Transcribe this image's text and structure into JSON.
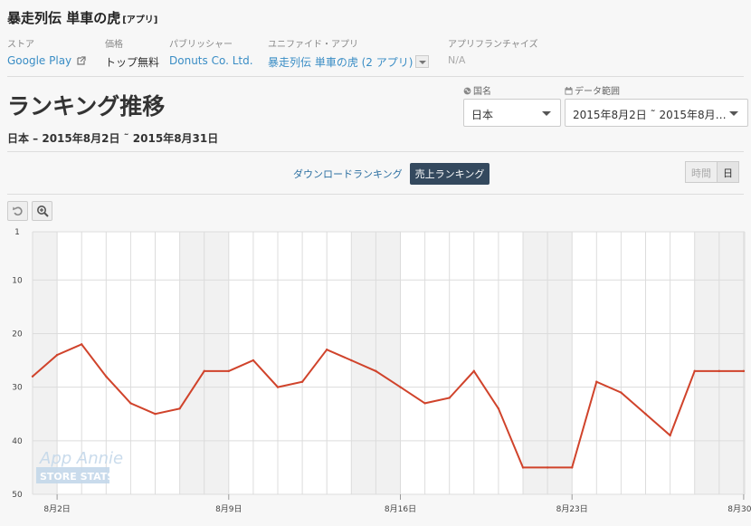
{
  "app": {
    "name": "暴走列伝 単車の虎",
    "tag": "[アプリ]"
  },
  "meta": {
    "store": {
      "label": "ストア",
      "value": "Google Play"
    },
    "price": {
      "label": "価格",
      "value": "トップ無料"
    },
    "publisher": {
      "label": "パブリッシャー",
      "value": "Donuts Co. Ltd."
    },
    "unified": {
      "label": "ユニファイド・アプリ",
      "value": "暴走列伝 単車の虎 (2 アプリ)"
    },
    "franchise": {
      "label": "アプリフランチャイズ",
      "value": "N/A"
    }
  },
  "page": {
    "title": "ランキング推移",
    "subtitle": "日本 – 2015年8月2日 ˜ 2015年8月31日"
  },
  "filters": {
    "country": {
      "label": "国名",
      "value": "日本"
    },
    "range": {
      "label": "データ範囲",
      "value": "2015年8月2日 ˜ 2015年8月…"
    }
  },
  "tabs": {
    "download": "ダウンロードランキング",
    "revenue": "売上ランキング"
  },
  "granularity": {
    "hour": "時間",
    "day": "日"
  },
  "colors": {
    "line": "#d0432b",
    "link": "#3a8dc5",
    "active_tab": "#34495e"
  },
  "watermark": {
    "line1": "App Annie",
    "line2": "STORE STATS"
  },
  "chart_data": {
    "type": "line",
    "title": "",
    "xlabel": "",
    "ylabel": "",
    "y_inverted": true,
    "ylim": [
      1,
      50
    ],
    "yticks": [
      1,
      10,
      20,
      30,
      40,
      50
    ],
    "xticks": [
      {
        "day": 2,
        "label": "8月2日"
      },
      {
        "day": 9,
        "label": "8月9日"
      },
      {
        "day": 16,
        "label": "8月16日"
      },
      {
        "day": 23,
        "label": "8月23日"
      },
      {
        "day": 30,
        "label": "8月30日"
      }
    ],
    "weekend_days": [
      2,
      8,
      9,
      15,
      16,
      22,
      23,
      29,
      30
    ],
    "series": [
      {
        "x": [
          1,
          2,
          3,
          4,
          5,
          6,
          7,
          8,
          9,
          10,
          11,
          12,
          13,
          14,
          15,
          16,
          17,
          18,
          19,
          20,
          21,
          22,
          23,
          24,
          25,
          26,
          27,
          28,
          29,
          30
        ],
        "values": [
          28,
          24,
          22,
          28,
          33,
          35,
          34,
          27,
          27,
          25,
          30,
          29,
          23,
          25,
          27,
          30,
          33,
          32,
          27,
          34,
          45,
          45,
          45,
          29,
          31,
          35,
          39,
          27,
          27,
          27
        ]
      }
    ]
  }
}
